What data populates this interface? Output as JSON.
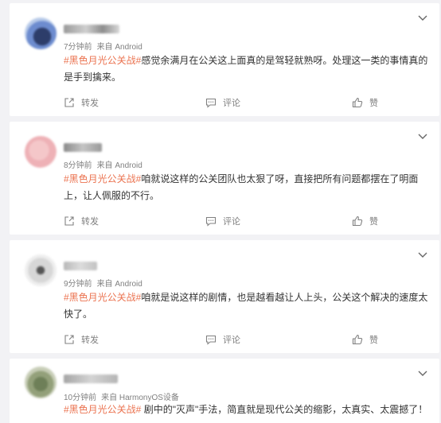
{
  "feed": {
    "posts": [
      {
        "time": "7分钟前",
        "source": "来自 Android",
        "hashtag": "#黑色月光公关战#",
        "text_line1": "感觉余满月在公关这上面真的是驾轻就熟呀。处理这一类的事情真的",
        "text_line2": "是手到擒来。",
        "actions": {
          "share": "转发",
          "comment": "评论",
          "like": "赞"
        }
      },
      {
        "time": "8分钟前",
        "source": "来自 Android",
        "hashtag": "#黑色月光公关战#",
        "text_line1": "咱就说这样的公关团队也太狠了呀，直接把所有问题都摆在了明面",
        "text_line2": "上，让人佩服的不行。",
        "actions": {
          "share": "转发",
          "comment": "评论",
          "like": "赞"
        }
      },
      {
        "time": "9分钟前",
        "source": "来自 Android",
        "hashtag": "#黑色月光公关战#",
        "text_line1": "咱就是说这样的剧情，也是越看越让人上头，公关这个解决的速度太",
        "text_line2": "快了。",
        "actions": {
          "share": "转发",
          "comment": "评论",
          "like": "赞"
        }
      },
      {
        "time": "10分钟前",
        "source": "来自 HarmonyOS设备",
        "hashtag": "#黑色月光公关战#",
        "text_line1": " 剧中的\"灭声\"手法，简直就是现代公关的缩影，太真实、太震撼了！",
        "text_line2": ""
      }
    ]
  },
  "icons": {
    "share": "share-icon",
    "comment": "comment-icon",
    "like": "thumbs-up-icon",
    "menu": "chevron-down-icon"
  },
  "colors": {
    "hashtag": "#eb7350",
    "text": "#333333",
    "meta": "#808080",
    "background": "#f2f2f5"
  }
}
